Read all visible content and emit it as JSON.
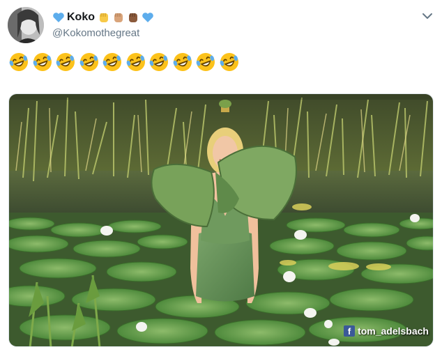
{
  "tweet": {
    "display_name": "Koko",
    "handle": "@Kokomothegreat",
    "name_emojis": [
      {
        "icon": "raised-fist-icon",
        "color": "#f7c948"
      },
      {
        "icon": "raised-fist-icon",
        "color": "#d9a47a"
      },
      {
        "icon": "raised-fist-icon",
        "color": "#8b5a3c"
      },
      {
        "icon": "blue-heart-icon",
        "color": "#5dadec"
      }
    ],
    "name_prefix_emoji": {
      "icon": "blue-heart-icon",
      "color": "#5dadec"
    },
    "body_emoji": {
      "icon": "rolling-on-floor-laughing-icon",
      "count": 10
    },
    "media": {
      "watermark_text": "tom_adelsbach",
      "watermark_logo": "f"
    }
  },
  "colors": {
    "handle": "#657786",
    "link_blue": "#5dadec",
    "facebook_blue": "#3b5998"
  }
}
